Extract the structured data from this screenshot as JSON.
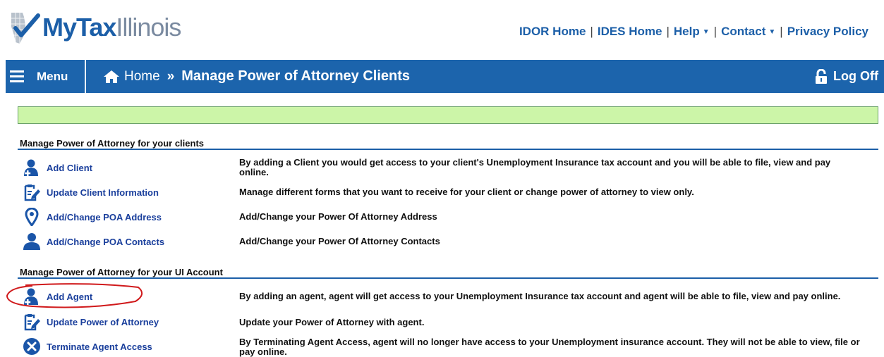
{
  "header": {
    "logo_part1": "MyTax",
    "logo_part2": "Illinois",
    "links": {
      "idor": "IDOR Home",
      "ides": "IDES Home",
      "help": "Help",
      "contact": "Contact",
      "privacy": "Privacy Policy"
    }
  },
  "navbar": {
    "menu_label": "Menu",
    "home_label": "Home",
    "separator": "»",
    "page_title": "Manage Power of Attorney Clients",
    "logoff_label": "Log Off"
  },
  "search": {
    "value": "",
    "placeholder": ""
  },
  "sections": [
    {
      "title": "Manage Power of Attorney for your clients",
      "items": [
        {
          "icon": "add-person-icon",
          "label": "Add Client",
          "description": "By adding a Client you would get access to your client's Unemployment Insurance tax account and you will be able to file, view and pay online."
        },
        {
          "icon": "edit-document-icon",
          "label": "Update Client Information",
          "description": "Manage different forms that you want to receive for your client or change power of attorney to view only."
        },
        {
          "icon": "map-pin-icon",
          "label": "Add/Change POA Address",
          "description": "Add/Change your Power Of Attorney Address"
        },
        {
          "icon": "person-icon",
          "label": "Add/Change POA Contacts",
          "description": "Add/Change your Power Of Attorney Contacts"
        }
      ]
    },
    {
      "title": "Manage Power of Attorney for your UI Account",
      "items": [
        {
          "icon": "add-person-icon",
          "label": "Add Agent",
          "description": "By adding an agent, agent will get access to your Unemployment Insurance tax account and agent will be able to file, view and pay online."
        },
        {
          "icon": "edit-document-icon",
          "label": "Update Power of Attorney",
          "description": "Update your Power of Attorney with agent."
        },
        {
          "icon": "close-circle-icon",
          "label": "Terminate Agent Access",
          "description": "By Terminating Agent Access, agent will no longer have access to your Unemployment insurance account. They will not be able to view, file or pay online."
        }
      ]
    }
  ],
  "colors": {
    "brand_blue": "#1c64ac",
    "link_blue": "#1a3f9c",
    "search_bg": "#ccf5a8",
    "annotation_red": "#d0191b"
  }
}
